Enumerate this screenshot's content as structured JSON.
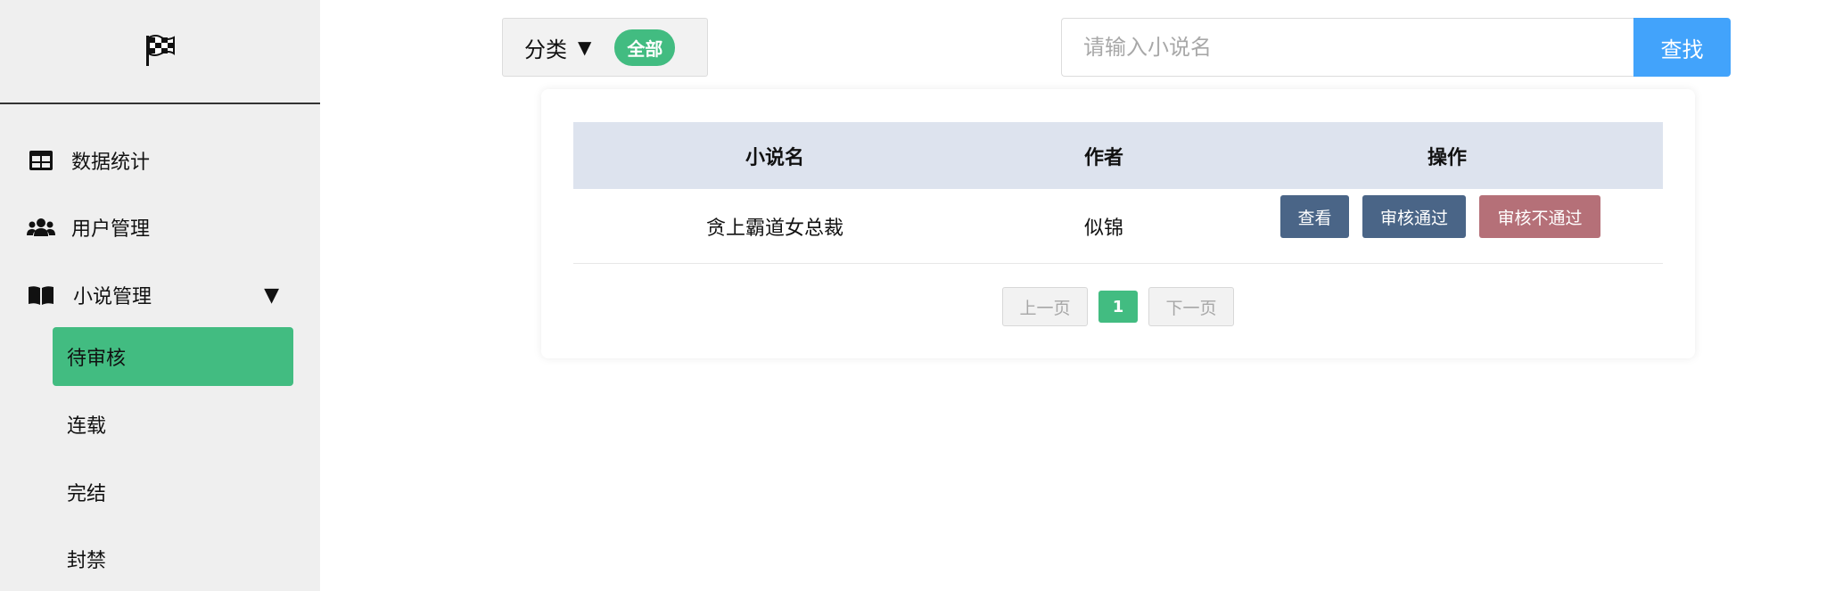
{
  "sidebar": {
    "logo_icon": "checkered-flag-icon",
    "items": [
      {
        "label": "数据统计",
        "icon": "table-icon"
      },
      {
        "label": "用户管理",
        "icon": "users-icon"
      },
      {
        "label": "小说管理",
        "icon": "book-open-icon",
        "caret": "▼"
      }
    ],
    "sub_items": [
      {
        "label": "待审核",
        "active": true
      },
      {
        "label": "连载"
      },
      {
        "label": "完结"
      },
      {
        "label": "封禁"
      }
    ]
  },
  "toolbar": {
    "category_label": "分类",
    "category_caret": "▼",
    "category_selected": "全部",
    "search_placeholder": "请输入小说名",
    "search_button": "查找"
  },
  "table": {
    "headers": [
      "小说名",
      "作者",
      "操作"
    ],
    "rows": [
      {
        "title": "贪上霸道女总裁",
        "author": "似锦",
        "actions": [
          "查看",
          "审核通过",
          "审核不通过"
        ]
      }
    ]
  },
  "pagination": {
    "prev": "上一页",
    "current": "1",
    "next": "下一页"
  },
  "colors": {
    "accent_green": "#42bc81",
    "search_blue": "#42a3fb",
    "button_dark": "#4a6587",
    "button_red": "#b57078"
  }
}
